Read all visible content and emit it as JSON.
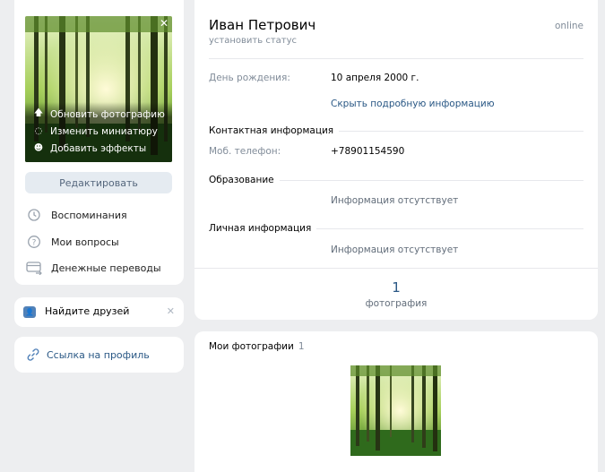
{
  "sidebar": {
    "photo_menu": {
      "update": "Обновить фотографию",
      "thumbnail": "Изменить миниатюру",
      "effects": "Добавить эффекты"
    },
    "edit_button": "Редактировать",
    "links": {
      "memories": "Воспоминания",
      "questions": "Мои вопросы",
      "transfers": "Денежные переводы"
    },
    "find_friends": "Найдите друзей",
    "profile_link": "Ссылка на профиль"
  },
  "profile": {
    "name": "Иван Петрович",
    "status_link": "установить статус",
    "online": "online",
    "birthday_label": "День рождения:",
    "birthday_value": "10 апреля 2000 г.",
    "hide_details": "Скрыть подробную информацию",
    "contacts_title": "Контактная информация",
    "phone_label": "Моб. телефон:",
    "phone_value": "+78901154590",
    "education_title": "Образование",
    "education_value": "Информация отсутствует",
    "personal_title": "Личная информация",
    "personal_value": "Информация отсутствует",
    "photo_count": "1",
    "photo_count_label": "фотография"
  },
  "photos": {
    "title": "Мои фотографии",
    "count": "1"
  }
}
